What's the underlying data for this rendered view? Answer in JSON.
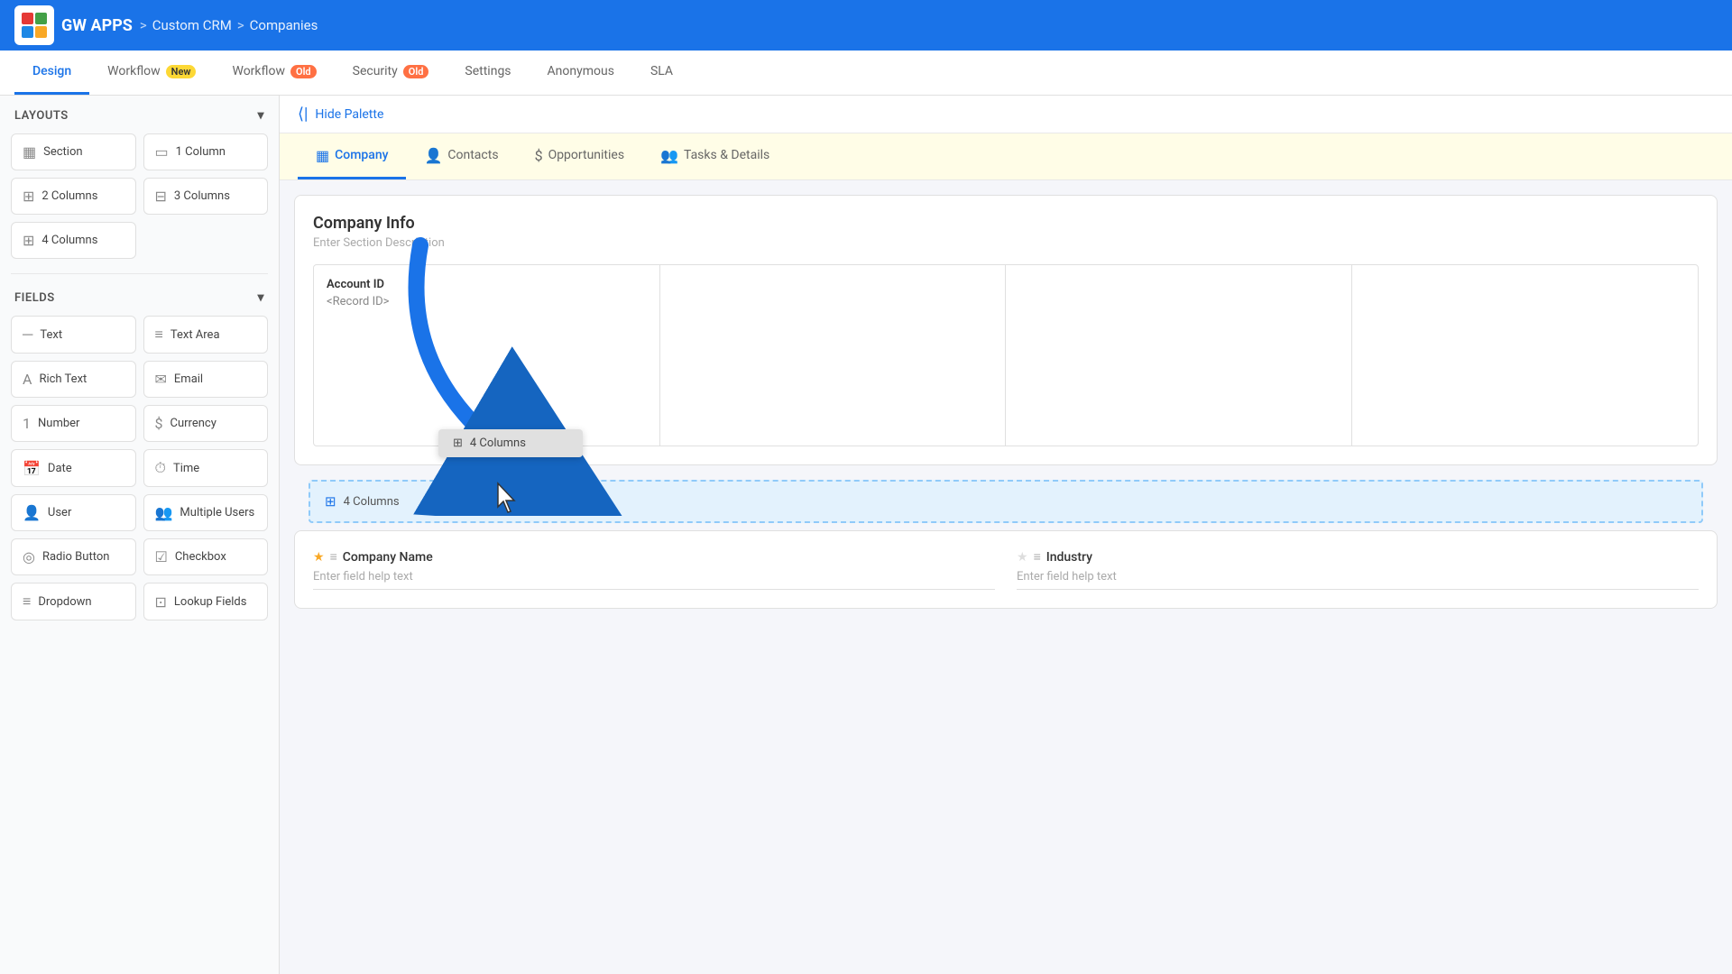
{
  "app": {
    "name": "GW APPS",
    "breadcrumb": {
      "sep": ">",
      "app": "Custom CRM",
      "page": "Companies"
    }
  },
  "tabs": [
    {
      "id": "design",
      "label": "Design",
      "active": true
    },
    {
      "id": "workflow-new",
      "label": "Workflow",
      "badge": "New",
      "badge_type": "new"
    },
    {
      "id": "workflow-old",
      "label": "Workflow",
      "badge": "Old",
      "badge_type": "old"
    },
    {
      "id": "security",
      "label": "Security",
      "badge": "Old",
      "badge_type": "old"
    },
    {
      "id": "settings",
      "label": "Settings"
    },
    {
      "id": "anonymous",
      "label": "Anonymous"
    },
    {
      "id": "sla",
      "label": "SLA"
    }
  ],
  "sidebar": {
    "layouts_label": "Layouts",
    "fields_label": "Fields",
    "layouts": [
      {
        "label": "Section",
        "icon": "▦"
      },
      {
        "label": "1 Column",
        "icon": "▭"
      },
      {
        "label": "2 Columns",
        "icon": "⊞"
      },
      {
        "label": "3 Columns",
        "icon": "⊟"
      },
      {
        "label": "4 Columns",
        "icon": "⊞",
        "active": true
      },
      {
        "label": "",
        "icon": ""
      }
    ],
    "fields": [
      {
        "label": "Text",
        "icon": "─"
      },
      {
        "label": "Text Area",
        "icon": "≡"
      },
      {
        "label": "Rich Text",
        "icon": "A"
      },
      {
        "label": "Email",
        "icon": "✉"
      },
      {
        "label": "Number",
        "icon": "1"
      },
      {
        "label": "Currency",
        "icon": "$"
      },
      {
        "label": "Date",
        "icon": "📅"
      },
      {
        "label": "Time",
        "icon": "⏱"
      },
      {
        "label": "User",
        "icon": "👤"
      },
      {
        "label": "Multiple Users",
        "icon": "👥"
      },
      {
        "label": "Radio Button",
        "icon": "◎"
      },
      {
        "label": "Checkbox",
        "icon": "☑"
      },
      {
        "label": "Dropdown",
        "icon": "≡"
      },
      {
        "label": "Lookup Fields",
        "icon": "⊡"
      }
    ]
  },
  "palette_bar": {
    "label": "Hide Palette"
  },
  "form_tabs": [
    {
      "id": "company",
      "label": "Company",
      "icon": "▦",
      "active": true
    },
    {
      "id": "contacts",
      "label": "Contacts",
      "icon": "👤"
    },
    {
      "id": "opportunities",
      "label": "Opportunities",
      "icon": "$"
    },
    {
      "id": "tasks",
      "label": "Tasks & Details",
      "icon": "👥"
    }
  ],
  "section": {
    "title": "Company Info",
    "description": "Enter Section Description",
    "field_label": "Account ID",
    "field_value": "<Record ID>"
  },
  "drag_ghost": {
    "label": "4 Columns"
  },
  "drag_row": {
    "label": "4 Columns"
  },
  "bottom_section": {
    "field1_name": "Company Name",
    "field1_help": "Enter field help text",
    "field1_star": "★",
    "field2_name": "Industry",
    "field2_help": "Enter field help text"
  },
  "colors": {
    "primary": "#1a73e8",
    "accent_yellow": "#fffde7",
    "drag_highlight": "#e3f2fd"
  }
}
